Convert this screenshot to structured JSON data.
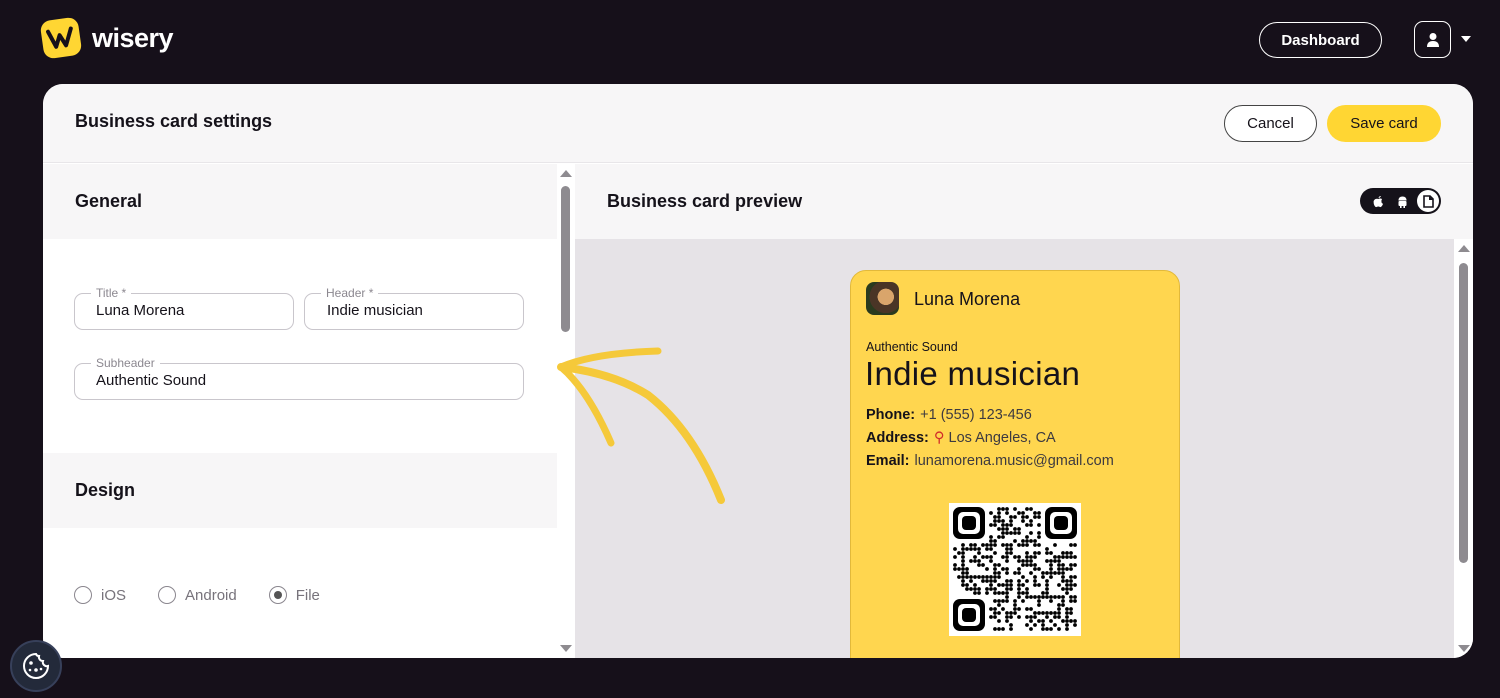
{
  "topbar": {
    "logo_text": "wisery",
    "dashboard_label": "Dashboard",
    "user_icon": "user-icon",
    "menu_icon": "caret-down-icon"
  },
  "panel": {
    "title": "Business card settings",
    "cancel_label": "Cancel",
    "save_label": "Save card"
  },
  "settings": {
    "general": {
      "heading": "General",
      "title_field": {
        "label": "Title *",
        "value": "Luna Morena"
      },
      "header_field": {
        "label": "Header *",
        "value": "Indie musician"
      },
      "subheader_field": {
        "label": "Subheader",
        "value": "Authentic Sound"
      }
    },
    "design": {
      "heading": "Design",
      "platform_options": [
        "iOS",
        "Android",
        "File"
      ],
      "selected_platform": "File"
    }
  },
  "preview": {
    "title": "Business card preview",
    "toggle_icons": [
      "apple-icon",
      "android-icon",
      "file-icon"
    ],
    "active_toggle": "file-icon",
    "card": {
      "name": "Luna Morena",
      "subheader": "Authentic Sound",
      "header": "Indie musician",
      "phone_label": "Phone:",
      "phone": "+1 (555) 123-456",
      "address_label": "Address:",
      "address": "Los Angeles, CA",
      "email_label": "Email:",
      "email": "lunamorena.music@gmail.com",
      "background_color": "#ffd64f"
    }
  },
  "colors": {
    "brand_yellow": "#ffd633",
    "page_dark": "#16101a"
  }
}
